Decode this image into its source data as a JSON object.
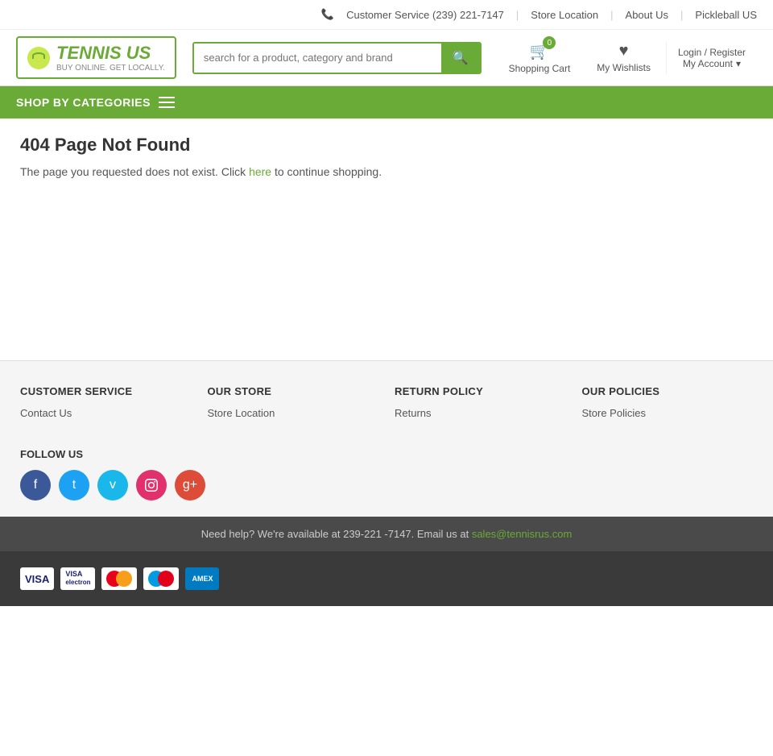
{
  "topbar": {
    "phone_label": "Customer Service (239) 221-7147",
    "store_location": "Store Location",
    "about_us": "About Us",
    "pickleball": "Pickleball US"
  },
  "logo": {
    "brand": "TENNIS US",
    "subtext": "BUY ONLINE. GET LOCALLY."
  },
  "search": {
    "placeholder": "search for a product, category and brand"
  },
  "cart": {
    "label": "Shopping Cart",
    "badge": "0"
  },
  "wishlist": {
    "label": "My Wishlists"
  },
  "account": {
    "login_label": "Login / Register",
    "account_label": "My Account"
  },
  "nav": {
    "shop_by_categories": "SHOP BY CATEGORIES"
  },
  "page": {
    "title": "404 Page Not Found",
    "message": "The page you requested does not exist. Click",
    "here": "here",
    "message_end": "to continue shopping."
  },
  "footer": {
    "customer_service": {
      "heading": "CUSTOMER SERVICE",
      "links": [
        {
          "label": "Contact Us",
          "href": "#"
        }
      ]
    },
    "our_store": {
      "heading": "OUR STORE",
      "links": [
        {
          "label": "Store Location",
          "href": "#"
        }
      ]
    },
    "return_policy": {
      "heading": "RETURN POLICY",
      "links": [
        {
          "label": "Returns",
          "href": "#"
        }
      ]
    },
    "our_policies": {
      "heading": "OUR POLICIES",
      "links": [
        {
          "label": "Store Policies",
          "href": "#"
        }
      ]
    },
    "follow_us": {
      "heading": "FOLLOW US"
    }
  },
  "footer_bottom": {
    "message": "Need help? We're available at 239-221 -7147. Email us at",
    "email": "sales@tennisrus.com"
  },
  "payment": {
    "methods": [
      "Visa",
      "Visa Electron",
      "Mastercard",
      "Maestro",
      "American Express"
    ]
  }
}
